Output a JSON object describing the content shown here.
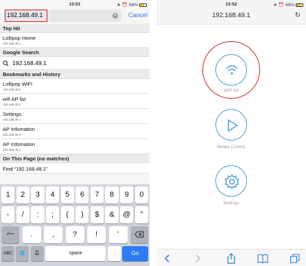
{
  "left": {
    "status": {
      "time": "13:51",
      "battery": "69%"
    },
    "search": {
      "value": "192.168.49.1",
      "cancel_label": "Cancel"
    },
    "sections": [
      {
        "header": "Top Hit",
        "items": [
          {
            "title": "Lollipop Home",
            "subtitle": "192.168.49.1"
          }
        ]
      },
      {
        "header": "Google Search",
        "google_query": "192.168.49.1"
      },
      {
        "header": "Bookmarks and History",
        "items": [
          {
            "title": "Lollipop WiFi",
            "subtitle": "192.168.49.1"
          },
          {
            "title": "wifi AP list",
            "subtitle": "192.168.49.1"
          },
          {
            "title": "Settings",
            "subtitle": "192.168.49.1"
          },
          {
            "title": "AP Infomation",
            "subtitle": "192.168.49.1"
          },
          {
            "title": "AP Infomation",
            "subtitle": "192.168.49.1"
          }
        ]
      },
      {
        "header": "On This Page (no matches)",
        "find_text": "Find “192.168.49.1”"
      }
    ],
    "keyboard": {
      "row1": [
        "1",
        "2",
        "3",
        "4",
        "5",
        "6",
        "7",
        "8",
        "9",
        "0"
      ],
      "row2": [
        "-",
        "/",
        ":",
        ";",
        "(",
        ")",
        "$",
        "&",
        "@",
        "”"
      ],
      "row3": [
        ".",
        ",",
        "?",
        "!",
        "’"
      ],
      "shift_label": "#+=",
      "abc_label": "ABC",
      "space_label": "space",
      "period_label": ".",
      "go_label": "Go"
    },
    "colors": {
      "highlight": "#d21c1c",
      "accent": "#2a7ae2",
      "go_key": "#2d7cf6"
    }
  },
  "right": {
    "status": {
      "time": "13:52",
      "battery": "69%"
    },
    "address": "192.168.49.1",
    "buttons": [
      {
        "caption": "WiFi AP",
        "icon": "wifi-icon"
      },
      {
        "caption": "Media Control",
        "icon": "play-icon"
      },
      {
        "caption": "Settings",
        "icon": "gear-icon"
      }
    ],
    "toolbar_icons": [
      "back-icon",
      "forward-icon",
      "share-icon",
      "bookmarks-icon",
      "tabs-icon"
    ],
    "colors": {
      "icon_blue": "#4d9fcf",
      "highlight": "#d21c1c"
    }
  }
}
